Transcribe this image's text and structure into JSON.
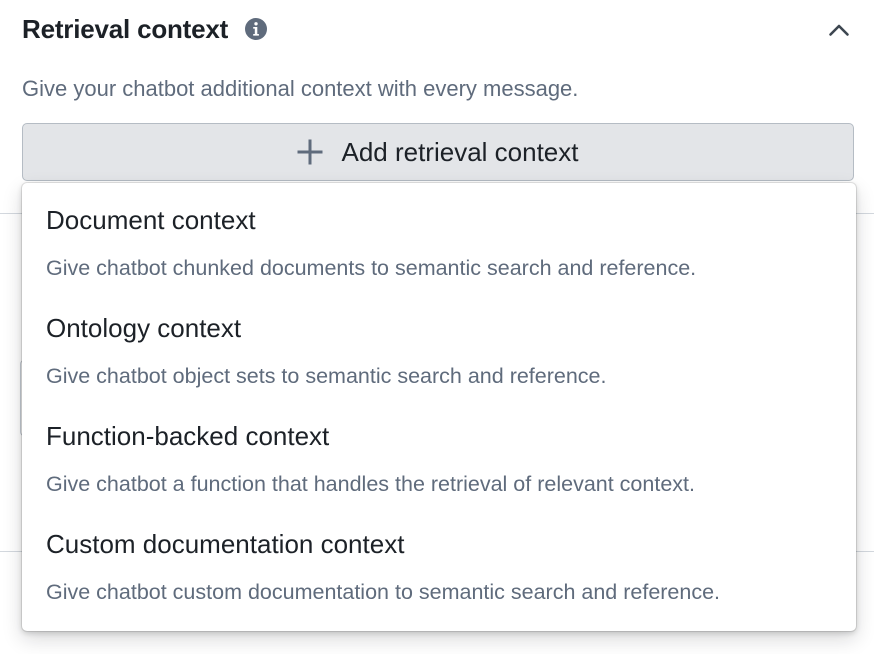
{
  "section": {
    "title": "Retrieval context",
    "info_icon": "info-circle-icon",
    "collapse_icon": "chevron-up-icon",
    "description": "Give your chatbot additional context with every message."
  },
  "add_button": {
    "icon": "plus-icon",
    "label": "Add retrieval context"
  },
  "menu": {
    "items": [
      {
        "title": "Document context",
        "description": "Give chatbot chunked documents to semantic search and reference."
      },
      {
        "title": "Ontology context",
        "description": "Give chatbot object sets to semantic search and reference."
      },
      {
        "title": "Function-backed context",
        "description": "Give chatbot a function that handles the retrieval of relevant context."
      },
      {
        "title": "Custom documentation context",
        "description": "Give chatbot custom documentation to semantic search and reference."
      }
    ]
  },
  "colors": {
    "text_primary": "#1c2127",
    "text_muted": "#5f6b7c",
    "button_bg": "#e3e5e8",
    "icon": "#5f6b7c"
  }
}
